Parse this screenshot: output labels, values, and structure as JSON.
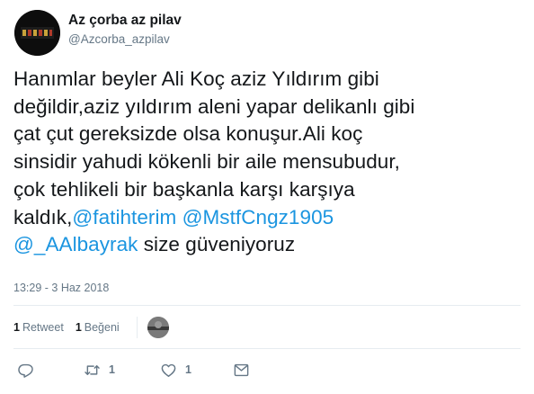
{
  "user": {
    "display_name": "Az çorba az pilav",
    "handle": "@Azcorba_azpilav"
  },
  "tweet": {
    "lines": [
      [
        {
          "t": "Hanımlar beyler Ali Koç aziz Yıldırım gibi",
          "m": false
        }
      ],
      [
        {
          "t": "değildir,aziz yıldırım aleni yapar delikanlı gibi",
          "m": false
        }
      ],
      [
        {
          "t": "çat çut gereksizde olsa konuşur.Ali koç",
          "m": false
        }
      ],
      [
        {
          "t": "sinsidir yahudi kökenli bir aile mensubudur,",
          "m": false
        }
      ],
      [
        {
          "t": "çok tehlikeli bir başkanla karşı karşıya",
          "m": false
        }
      ],
      [
        {
          "t": "kaldık,",
          "m": false
        },
        {
          "t": "@fatihterim",
          "m": true
        },
        {
          "t": " ",
          "m": false
        },
        {
          "t": "@MstfCngz1905",
          "m": true
        }
      ],
      [
        {
          "t": "@_AAlbayrak",
          "m": true
        },
        {
          "t": " size güveniyoruz",
          "m": false
        }
      ]
    ],
    "timestamp": "13:29 - 3 Haz 2018"
  },
  "stats": {
    "retweet_count": "1",
    "retweet_label": "Retweet",
    "like_count": "1",
    "like_label": "Beğeni"
  },
  "actions": {
    "retweet_count": "1",
    "like_count": "1"
  },
  "colors": {
    "link": "#1b95e0",
    "secondary": "#657786",
    "divider": "#e6ecf0"
  },
  "icons": [
    "reply-icon",
    "retweet-icon",
    "like-icon",
    "message-icon"
  ]
}
